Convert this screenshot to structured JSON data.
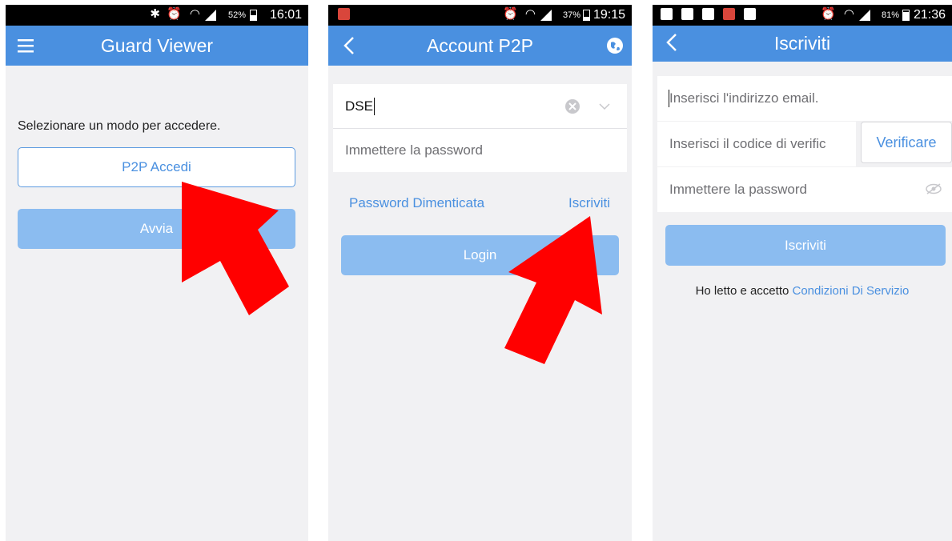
{
  "screen1": {
    "status": {
      "battery": "52%",
      "time": "16:01",
      "icons": [
        "bluetooth-icon",
        "alarm-icon",
        "wifi-icon",
        "signal-icon",
        "battery-icon"
      ]
    },
    "appbar": {
      "title": "Guard Viewer",
      "menu_icon": "menu-icon"
    },
    "prompt": "Selezionare un modo per accedere.",
    "p2p_button": "P2P Accedi",
    "start_button": "Avvia"
  },
  "screen2": {
    "status": {
      "battery": "37%",
      "time": "19:15",
      "icons": [
        "notification-app-icon",
        "alarm-icon",
        "wifi-icon",
        "signal-icon",
        "battery-icon"
      ]
    },
    "appbar": {
      "title": "Account P2P",
      "back_icon": "back-icon",
      "globe_icon": "globe-icon"
    },
    "username": {
      "value": "DSE"
    },
    "password": {
      "placeholder": "Immettere la password"
    },
    "forgot_link": "Password Dimenticata",
    "register_link": "Iscriviti",
    "login_button": "Login"
  },
  "screen3": {
    "status": {
      "battery": "81%",
      "time": "21:36",
      "icons": [
        "notification-icons",
        "alarm-icon",
        "wifi-icon",
        "signal-icon",
        "battery-charging-icon"
      ]
    },
    "appbar": {
      "title": "Iscriviti",
      "back_icon": "back-icon"
    },
    "email": {
      "placeholder": "Inserisci l'indirizzo email."
    },
    "code": {
      "placeholder": "Inserisci il codice di verific",
      "verify_button": "Verificare"
    },
    "password": {
      "placeholder": "Immettere la password"
    },
    "register_button": "Iscriviti",
    "terms_prefix": "Ho letto e accetto",
    "terms_link": "Condizioni Di Servizio"
  },
  "colors": {
    "accent": "#4a90e0",
    "button_disabled": "#8bbcf0",
    "arrow": "#ff0000"
  }
}
